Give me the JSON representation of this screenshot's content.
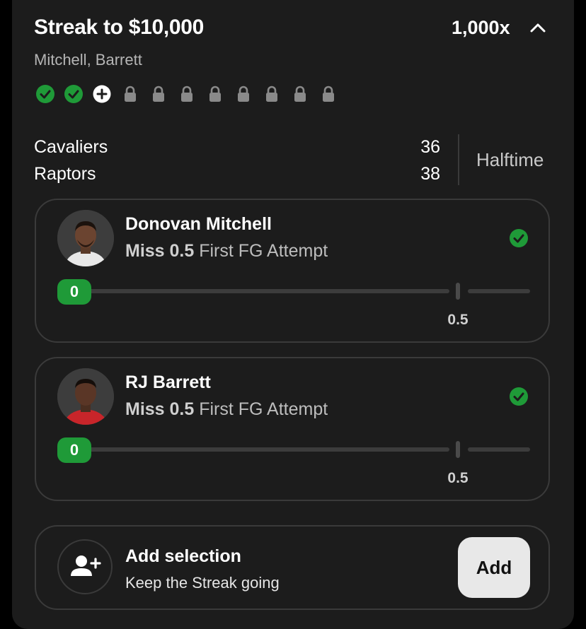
{
  "header": {
    "title": "Streak to $10,000",
    "multiplier": "1,000x",
    "subtitle": "Mitchell, Barrett"
  },
  "progress": {
    "completed": 2,
    "current": 1,
    "locked": 8
  },
  "game": {
    "teams": [
      {
        "name": "Cavaliers",
        "score": "36"
      },
      {
        "name": "Raptors",
        "score": "38"
      }
    ],
    "status": "Halftime"
  },
  "picks": [
    {
      "player": "Donovan Mitchell",
      "outcome": "Miss 0.5",
      "market": "First FG Attempt",
      "current_value": "0",
      "threshold": "0.5",
      "status_icon": "check-circle-icon"
    },
    {
      "player": "RJ Barrett",
      "outcome": "Miss 0.5",
      "market": "First FG Attempt",
      "current_value": "0",
      "threshold": "0.5",
      "status_icon": "check-circle-icon"
    }
  ],
  "add": {
    "title": "Add selection",
    "subtitle": "Keep the Streak going",
    "button": "Add",
    "icon": "add-user-icon"
  },
  "colors": {
    "background": "#000000",
    "card": "#1c1c1c",
    "success": "#1f9a38",
    "border": "#3a3a3a",
    "button": "#e8e8e8"
  }
}
